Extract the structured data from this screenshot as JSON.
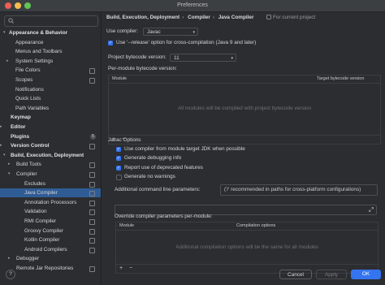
{
  "window": {
    "title": "Preferences"
  },
  "colors": {
    "accent": "#3574f0",
    "selection": "#2f5c95",
    "close": "#ec5f56",
    "minimize": "#f4bd4f",
    "zoom": "#60c454"
  },
  "search": {
    "placeholder": ""
  },
  "sidebar": {
    "items": [
      {
        "label": "Appearance & Behavior",
        "bold": true,
        "arrow": "down"
      },
      {
        "label": "Appearance"
      },
      {
        "label": "Menus and Toolbars"
      },
      {
        "label": "System Settings",
        "arrow": "right"
      },
      {
        "label": "File Colors",
        "ind": true
      },
      {
        "label": "Scopes",
        "ind": true
      },
      {
        "label": "Notifications"
      },
      {
        "label": "Quick Lists"
      },
      {
        "label": "Path Variables"
      },
      {
        "label": "Keymap",
        "bold": true
      },
      {
        "label": "Editor",
        "bold": true,
        "arrow": "right"
      },
      {
        "label": "Plugins",
        "bold": true,
        "badge": "5"
      },
      {
        "label": "Version Control",
        "bold": true,
        "arrow": "right",
        "ind": true
      },
      {
        "label": "Build, Execution, Deployment",
        "bold": true,
        "arrow": "down"
      },
      {
        "label": "Build Tools",
        "arrow": "right",
        "ind": true
      },
      {
        "label": "Compiler",
        "arrow": "down",
        "ind": true
      },
      {
        "label": "Excludes",
        "ind": true
      },
      {
        "label": "Java Compiler",
        "ind": true,
        "selected": true
      },
      {
        "label": "Annotation Processors",
        "ind": true
      },
      {
        "label": "Validation",
        "ind": true
      },
      {
        "label": "RMI Compiler",
        "ind": true
      },
      {
        "label": "Groovy Compiler",
        "ind": true
      },
      {
        "label": "Kotlin Compiler",
        "ind": true
      },
      {
        "label": "Android Compilers",
        "ind": true
      },
      {
        "label": "Debugger",
        "arrow": "right"
      },
      {
        "label": "Remote Jar Repositories",
        "ind": true
      }
    ]
  },
  "breadcrumb": {
    "items": [
      "Build, Execution, Deployment",
      "Compiler",
      "Java Compiler"
    ],
    "separator": "›",
    "scope": "For current project"
  },
  "compiler": {
    "use_label": "Use compiler:",
    "value": "Javac",
    "release_option": "Use '--release' option for cross-compilation (Java 9 and later)",
    "bytecode_label": "Project bytecode version:",
    "bytecode_value": "11",
    "per_module_label": "Per-module bytecode version:",
    "module_cols": [
      "Module",
      "Target bytecode version"
    ],
    "module_empty": "All modules will be compiled with project bytecode version",
    "add": "+",
    "remove": "−"
  },
  "javac": {
    "section": "Javac Options",
    "options": [
      {
        "label": "Use compiler from module target JDK when possible",
        "checked": true
      },
      {
        "label": "Generate debugging info",
        "checked": true
      },
      {
        "label": "Report use of deprecated features",
        "checked": true
      },
      {
        "label": "Generate no warnings",
        "checked": false
      }
    ],
    "additional_label": "Additional command line parameters:",
    "additional_hint": "('/' recommended in paths for cross-platform configurations)",
    "override_label": "Override compiler parameters per-module:",
    "override_cols": [
      "Module",
      "Compilation options"
    ],
    "override_empty": "Additional compilation options will be the same for all modules"
  },
  "buttons": {
    "help": "?",
    "cancel": "Cancel",
    "apply": "Apply",
    "ok": "OK"
  }
}
